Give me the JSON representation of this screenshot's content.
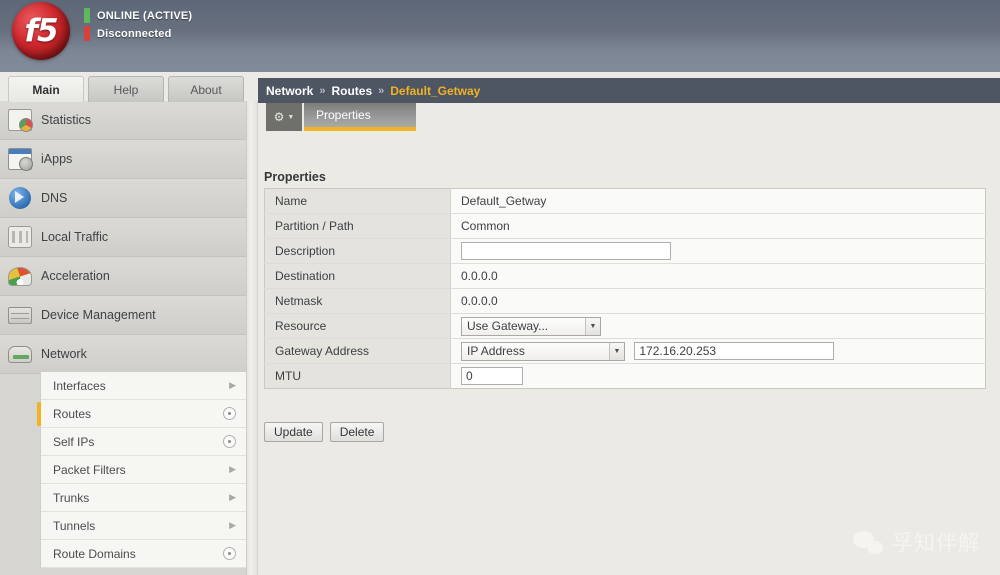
{
  "header": {
    "logo_text": "f5",
    "logo_icon": "f5-ball-logo",
    "status": [
      {
        "label": "ONLINE (ACTIVE)",
        "color": "#5eb85e",
        "icon": "status-bar-green"
      },
      {
        "label": "Disconnected",
        "color": "#d9403a",
        "icon": "status-bar-red"
      }
    ]
  },
  "top_tabs": [
    {
      "label": "Main",
      "active": true
    },
    {
      "label": "Help",
      "active": false
    },
    {
      "label": "About",
      "active": false
    }
  ],
  "sidebar": {
    "items": [
      {
        "label": "Statistics",
        "icon": "statistics-icon"
      },
      {
        "label": "iApps",
        "icon": "iapps-icon"
      },
      {
        "label": "DNS",
        "icon": "dns-globe-icon"
      },
      {
        "label": "Local Traffic",
        "icon": "local-traffic-icon"
      },
      {
        "label": "Acceleration",
        "icon": "acceleration-gauge-icon"
      },
      {
        "label": "Device Management",
        "icon": "device-management-icon"
      },
      {
        "label": "Network",
        "icon": "network-icon"
      }
    ],
    "submenu": [
      {
        "label": "Interfaces",
        "marker": "arrow",
        "active": false
      },
      {
        "label": "Routes",
        "marker": "circle",
        "active": true
      },
      {
        "label": "Self IPs",
        "marker": "circle",
        "active": false
      },
      {
        "label": "Packet Filters",
        "marker": "arrow",
        "active": false
      },
      {
        "label": "Trunks",
        "marker": "arrow",
        "active": false
      },
      {
        "label": "Tunnels",
        "marker": "arrow",
        "active": false
      },
      {
        "label": "Route Domains",
        "marker": "circle",
        "active": false
      }
    ]
  },
  "breadcrumb": {
    "items": [
      "Network",
      "Routes",
      "Default_Getway"
    ],
    "separator": "»",
    "current_color": "#f0b323"
  },
  "subtabs": {
    "gear_icon": "gear-icon",
    "caret_icon": "chevron-down-icon",
    "tabs": [
      {
        "label": "Properties",
        "active": true
      }
    ]
  },
  "main": {
    "section_title": "Properties",
    "rows": [
      {
        "label": "Name",
        "type": "text",
        "value": "Default_Getway"
      },
      {
        "label": "Partition / Path",
        "type": "text",
        "value": "Common"
      },
      {
        "label": "Description",
        "type": "input",
        "value": "",
        "placeholder": ""
      },
      {
        "label": "Destination",
        "type": "text",
        "value": "0.0.0.0"
      },
      {
        "label": "Netmask",
        "type": "text",
        "value": "0.0.0.0"
      },
      {
        "label": "Resource",
        "type": "select",
        "value": "Use Gateway..."
      },
      {
        "label": "Gateway Address",
        "type": "select-input",
        "select_value": "IP Address",
        "value": "172.16.20.253"
      },
      {
        "label": "MTU",
        "type": "input",
        "value": "0"
      }
    ],
    "buttons": [
      {
        "label": "Update",
        "name": "update-button"
      },
      {
        "label": "Delete",
        "name": "delete-button"
      }
    ]
  },
  "watermark": {
    "icon": "wechat-icon",
    "text": "孚知伴解"
  }
}
